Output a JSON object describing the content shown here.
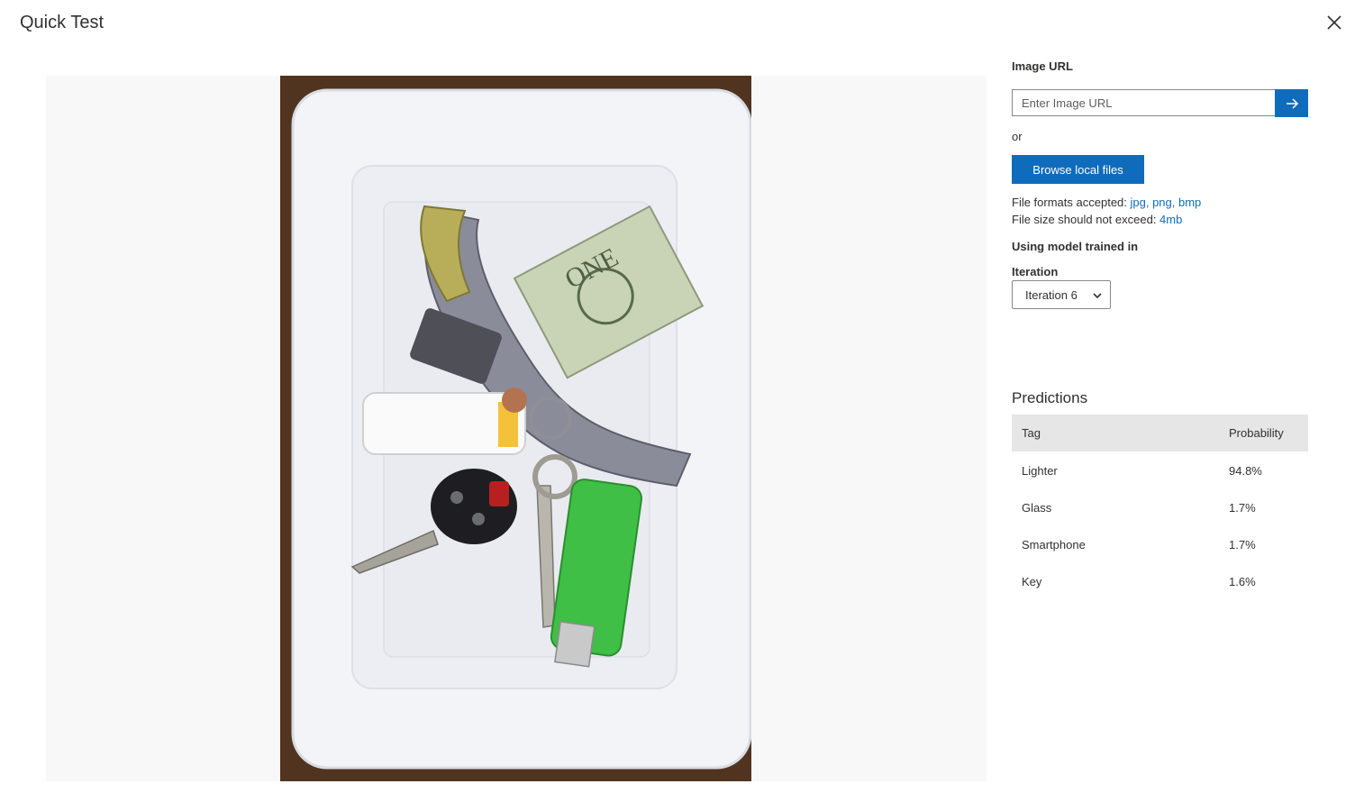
{
  "dialog": {
    "title": "Quick Test",
    "close_icon": "close-icon"
  },
  "image_url": {
    "label": "Image URL",
    "placeholder": "Enter Image URL",
    "submit_icon": "arrow-right-icon"
  },
  "or_text": "or",
  "browse_button": "Browse local files",
  "formats": {
    "label": "File formats accepted: ",
    "values": "jpg, png, bmp"
  },
  "size": {
    "label": "File size should not exceed: ",
    "value": "4mb"
  },
  "model_label": "Using model trained in",
  "iteration": {
    "label": "Iteration",
    "selected": "Iteration 6"
  },
  "predictions": {
    "title": "Predictions",
    "columns": {
      "tag": "Tag",
      "probability": "Probability"
    },
    "rows": [
      {
        "tag": "Lighter",
        "probability": "94.8%"
      },
      {
        "tag": "Glass",
        "probability": "1.7%"
      },
      {
        "tag": "Smartphone",
        "probability": "1.7%"
      },
      {
        "tag": "Key",
        "probability": "1.6%"
      }
    ]
  },
  "colors": {
    "accent": "#0f6cbd",
    "header_bg": "#e6e6e6",
    "image_bg": "#f8f8f8"
  }
}
